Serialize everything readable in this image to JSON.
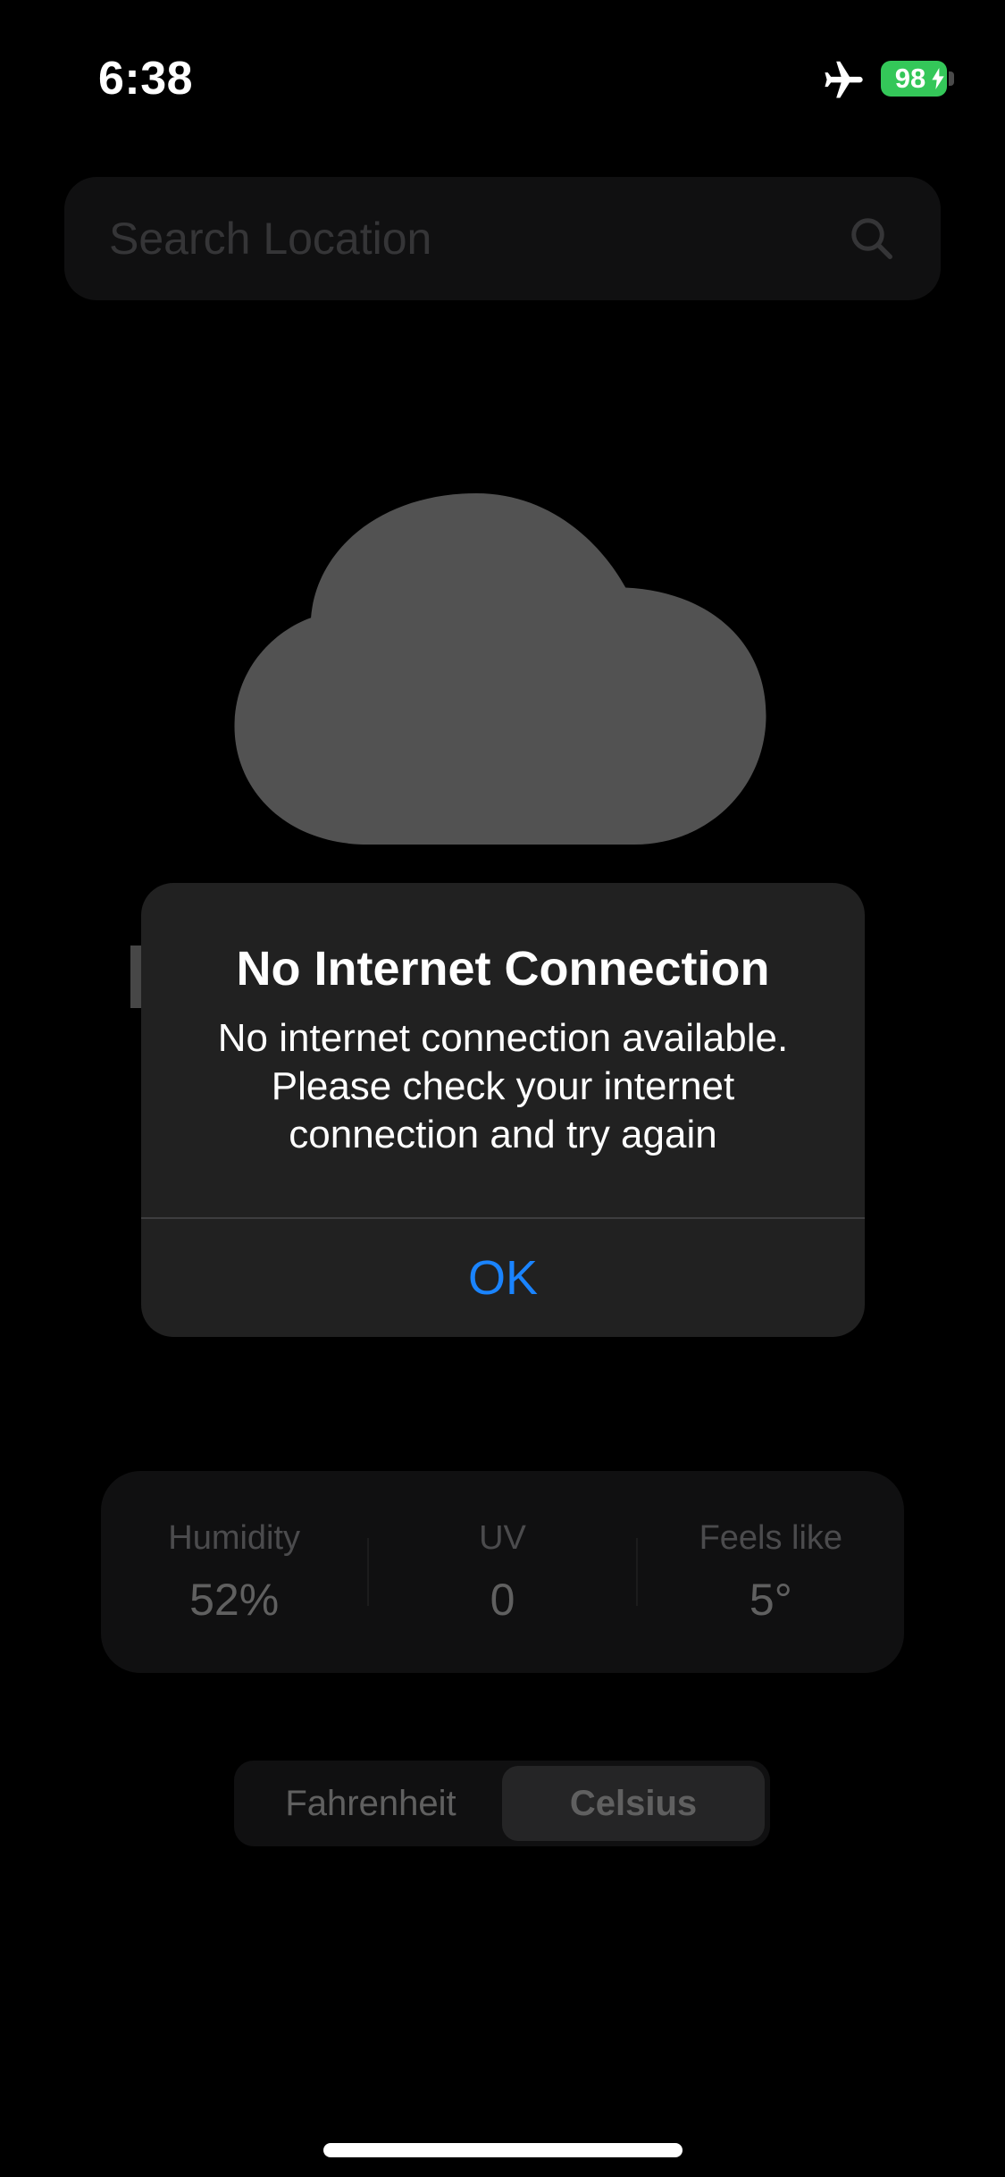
{
  "status_bar": {
    "time": "6:38",
    "battery": "98",
    "battery_color": "#34c759",
    "icons": [
      "airplane-icon",
      "battery-icon",
      "charging-bolt-icon"
    ]
  },
  "search": {
    "placeholder": "Search Location",
    "icon": "search-icon"
  },
  "weather": {
    "icon": "cloud-icon"
  },
  "stats": [
    {
      "label": "Humidity",
      "value": "52%"
    },
    {
      "label": "UV",
      "value": "0"
    },
    {
      "label": "Feels like",
      "value": "5°"
    }
  ],
  "units": {
    "options": [
      "Fahrenheit",
      "Celsius"
    ],
    "selected": "Celsius"
  },
  "alert": {
    "title": "No Internet Connection",
    "message": "No internet connection available. Please check your internet connection and try again",
    "button_label": "OK",
    "button_color": "#1a84ff"
  }
}
